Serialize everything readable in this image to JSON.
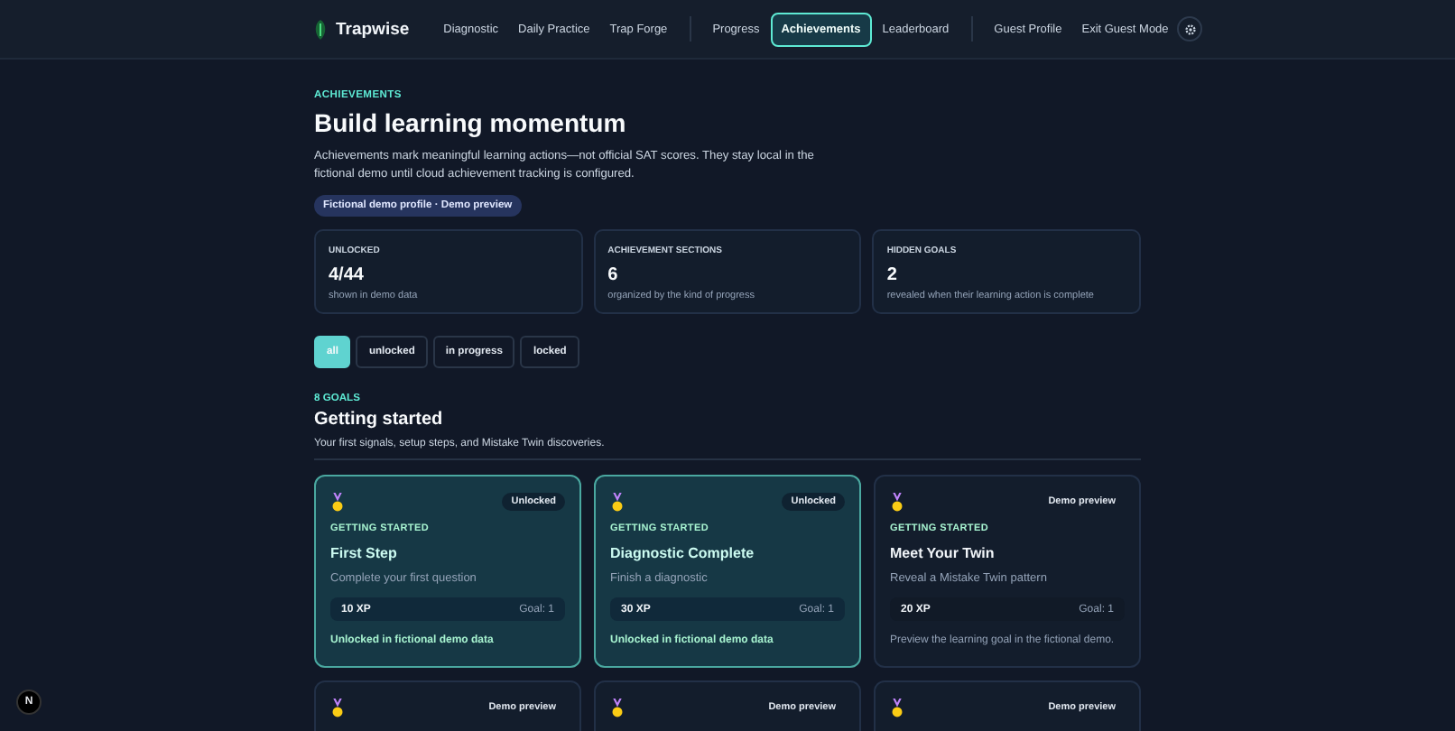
{
  "nav": {
    "brand": "Trapwise",
    "groups": [
      [
        {
          "label": "Diagnostic",
          "selected": false
        },
        {
          "label": "Daily Practice",
          "selected": false
        },
        {
          "label": "Trap Forge",
          "selected": false
        }
      ],
      [
        {
          "label": "Progress",
          "selected": false
        },
        {
          "label": "Achievements",
          "selected": true
        },
        {
          "label": "Leaderboard",
          "selected": false
        }
      ],
      [
        {
          "label": "Guest Profile",
          "selected": false
        },
        {
          "label": "Exit Guest Mode",
          "selected": false
        }
      ]
    ]
  },
  "hero": {
    "eyebrow": "ACHIEVEMENTS",
    "title": "Build learning momentum",
    "description": "Achievements mark meaningful learning actions—not official SAT scores. They stay local in the fictional demo until cloud achievement tracking is configured.",
    "badge": "Fictional demo profile · Demo preview"
  },
  "stats": [
    {
      "label": "UNLOCKED",
      "value": "4/44",
      "note": "shown in demo data"
    },
    {
      "label": "ACHIEVEMENT SECTIONS",
      "value": "6",
      "note": "organized by the kind of progress"
    },
    {
      "label": "HIDDEN GOALS",
      "value": "2",
      "note": "revealed when their learning action is complete"
    }
  ],
  "filters": [
    {
      "label": "all",
      "selected": true
    },
    {
      "label": "unlocked",
      "selected": false
    },
    {
      "label": "in progress",
      "selected": false
    },
    {
      "label": "locked",
      "selected": false
    }
  ],
  "section": {
    "count": "8 GOALS",
    "title": "Getting started",
    "description": "Your first signals, setup steps, and Mistake Twin discoveries.",
    "cards": [
      {
        "unlocked": true,
        "status": "Unlocked",
        "category": "GETTING STARTED",
        "title": "First Step",
        "description": "Complete your first question",
        "xp": "10 XP",
        "goal": "Goal: 1",
        "footer": "Unlocked in fictional demo data"
      },
      {
        "unlocked": true,
        "status": "Unlocked",
        "category": "GETTING STARTED",
        "title": "Diagnostic Complete",
        "description": "Finish a diagnostic",
        "xp": "30 XP",
        "goal": "Goal: 1",
        "footer": "Unlocked in fictional demo data"
      },
      {
        "unlocked": false,
        "status": "Demo preview",
        "category": "GETTING STARTED",
        "title": "Meet Your Twin",
        "description": "Reveal a Mistake Twin pattern",
        "xp": "20 XP",
        "goal": "Goal: 1",
        "footer": "Preview the learning goal in the fictional demo."
      },
      {
        "unlocked": false,
        "status": "Demo preview"
      },
      {
        "unlocked": false,
        "status": "Demo preview"
      },
      {
        "unlocked": false,
        "status": "Demo preview"
      }
    ]
  },
  "dev_badge": "N"
}
